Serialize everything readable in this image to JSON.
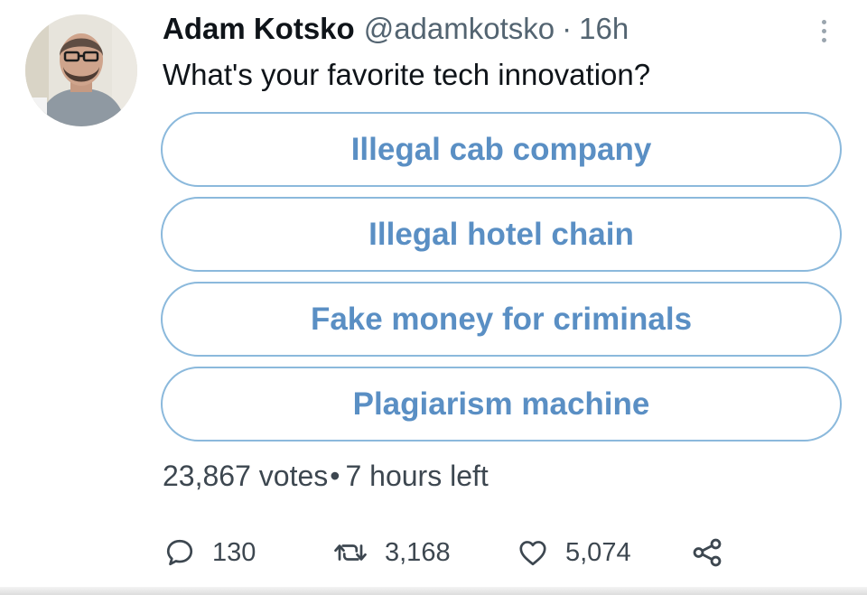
{
  "author": {
    "name": "Adam Kotsko",
    "handle": "@adamkotsko",
    "separator": "·",
    "time": "16h"
  },
  "tweet": {
    "text": "What's your favorite tech innovation?"
  },
  "poll": {
    "options": [
      {
        "label": "Illegal cab company"
      },
      {
        "label": "Illegal hotel chain"
      },
      {
        "label": "Fake money for criminals"
      },
      {
        "label": "Plagiarism machine"
      }
    ],
    "votes": "23,867 votes",
    "separator": "•",
    "time_left": "7 hours left"
  },
  "actions": {
    "reply_count": "130",
    "retweet_count": "3,168",
    "like_count": "5,074"
  },
  "icons": {
    "reply": "reply-icon",
    "retweet": "retweet-icon",
    "like": "heart-icon",
    "share": "share-icon",
    "more": "more-vertical-icon"
  },
  "colors": {
    "poll_accent": "#5a8fc4",
    "poll_border": "#8bb9dc",
    "secondary_text": "#536471",
    "primary_text": "#0f1419"
  }
}
